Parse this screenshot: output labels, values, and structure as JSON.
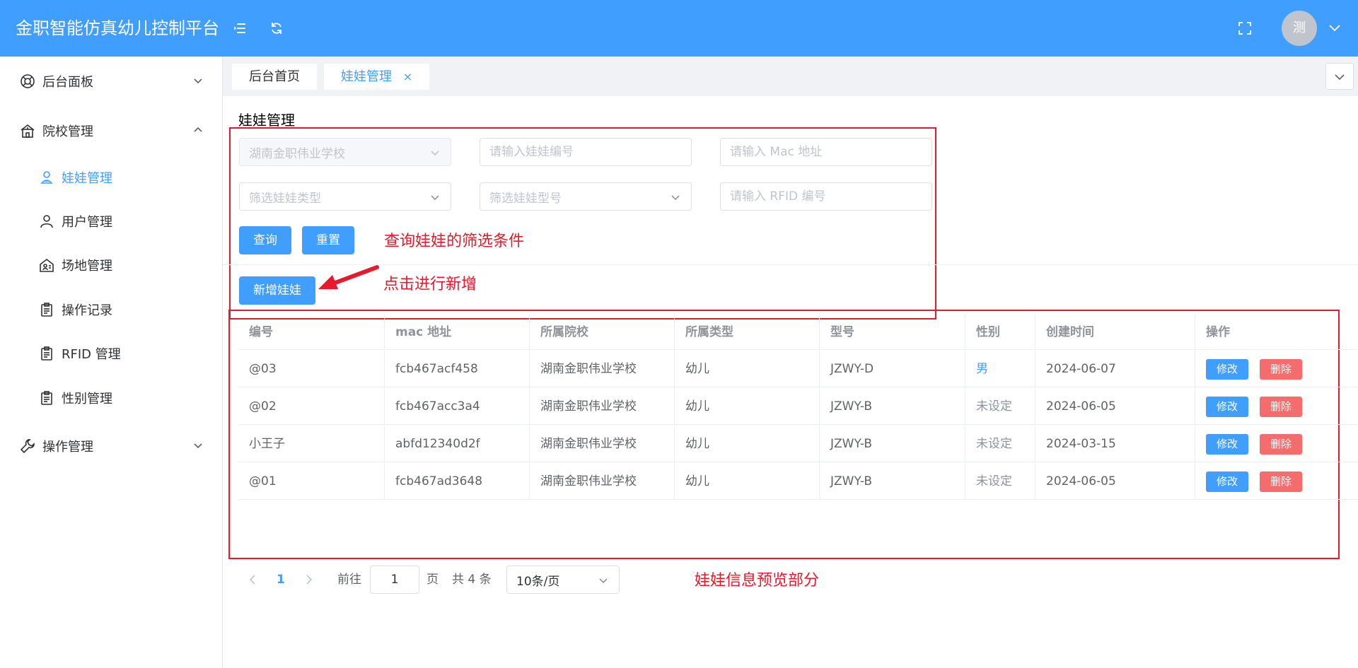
{
  "app": {
    "title": "金职智能仿真幼儿控制平台",
    "avatar_text": "测"
  },
  "sidebar": {
    "items": [
      {
        "label": "后台面板"
      },
      {
        "label": "院校管理"
      },
      {
        "label": "娃娃管理"
      },
      {
        "label": "用户管理"
      },
      {
        "label": "场地管理"
      },
      {
        "label": "操作记录"
      },
      {
        "label": "RFID 管理"
      },
      {
        "label": "性别管理"
      },
      {
        "label": "操作管理"
      }
    ]
  },
  "tabs": [
    {
      "label": "后台首页"
    },
    {
      "label": "娃娃管理",
      "close": "×"
    }
  ],
  "page": {
    "title": "娃娃管理"
  },
  "filters": {
    "school_select": "湖南金职伟业学校",
    "doll_number_placeholder": "请输入娃娃编号",
    "mac_placeholder": "请输入 Mac 地址",
    "doll_type_placeholder": "筛选娃娃类型",
    "doll_model_placeholder": "筛选娃娃型号",
    "rfid_placeholder": "请输入 RFID 编号",
    "query_label": "查询",
    "reset_label": "重置"
  },
  "actions": {
    "add_label": "新增娃娃"
  },
  "annotations": {
    "filter_note": "查询娃娃的筛选条件",
    "add_note": "点击进行新增",
    "table_note": "娃娃信息预览部分"
  },
  "table": {
    "headers": [
      "编号",
      "mac 地址",
      "所属院校",
      "所属类型",
      "型号",
      "性别",
      "创建时间",
      "操作"
    ],
    "rows": [
      {
        "number": "@03",
        "mac": "fcb467acf458",
        "school": "湖南金职伟业学校",
        "type": "幼儿",
        "model": "JZWY-D",
        "gender": "男",
        "created": "2024-06-07"
      },
      {
        "number": "@02",
        "mac": "fcb467acc3a4",
        "school": "湖南金职伟业学校",
        "type": "幼儿",
        "model": "JZWY-B",
        "gender": "未设定",
        "created": "2024-06-05"
      },
      {
        "number": "小王子",
        "mac": "abfd12340d2f",
        "school": "湖南金职伟业学校",
        "type": "幼儿",
        "model": "JZWY-B",
        "gender": "未设定",
        "created": "2024-03-15"
      },
      {
        "number": "@01",
        "mac": "fcb467ad3648",
        "school": "湖南金职伟业学校",
        "type": "幼儿",
        "model": "JZWY-B",
        "gender": "未设定",
        "created": "2024-06-05"
      }
    ],
    "edit_label": "修改",
    "delete_label": "删除"
  },
  "pagination": {
    "current_page": "1",
    "goto_prefix": "前往",
    "goto_value": "1",
    "goto_suffix": "页",
    "total_text": "共 4 条",
    "page_size": "10条/页"
  },
  "colors": {
    "primary": "#409eff",
    "danger": "#f56c6c",
    "annotation": "#e8192c"
  }
}
